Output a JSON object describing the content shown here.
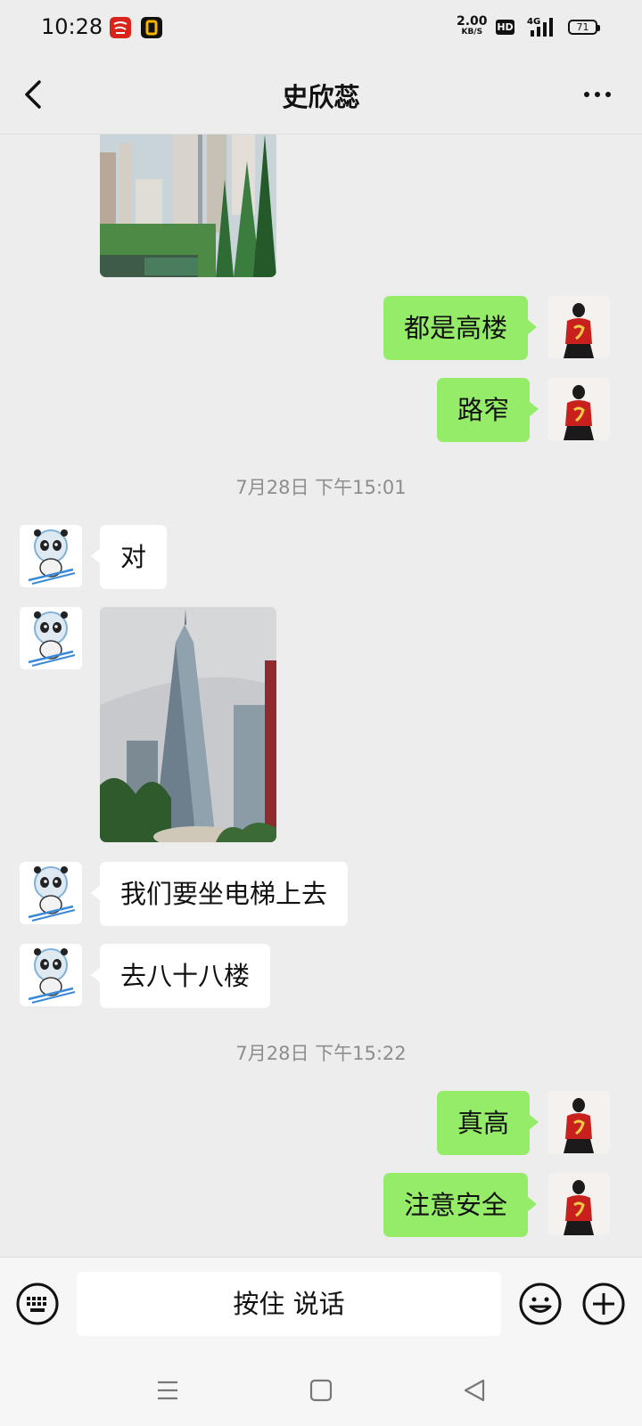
{
  "status_bar": {
    "time": "10:28",
    "net_speed": "2.00",
    "net_unit": "KB/S",
    "hd_label": "HD",
    "network_type": "4G",
    "battery": "71"
  },
  "header": {
    "title": "史欣蕊"
  },
  "messages": [
    {
      "type": "image",
      "direction": "in",
      "subject": "city street with trees and high-rise buildings"
    },
    {
      "type": "text",
      "direction": "out",
      "text": "都是高楼"
    },
    {
      "type": "text",
      "direction": "out",
      "text": "路窄"
    },
    {
      "type": "timestamp",
      "text": "7月28日 下午15:01"
    },
    {
      "type": "text",
      "direction": "in",
      "text": "对"
    },
    {
      "type": "image",
      "direction": "in",
      "subject": "skyscraper viewed from below"
    },
    {
      "type": "text",
      "direction": "in",
      "text": "我们要坐电梯上去"
    },
    {
      "type": "text",
      "direction": "in",
      "text": "去八十八楼"
    },
    {
      "type": "timestamp",
      "text": "7月28日 下午15:22"
    },
    {
      "type": "text",
      "direction": "out",
      "text": "真高"
    },
    {
      "type": "text",
      "direction": "out",
      "text": "注意安全"
    }
  ],
  "input_bar": {
    "voice_label": "按住 说话"
  },
  "icons": {
    "back": "chevron-left-icon",
    "more": "more-dots-icon",
    "keyboard": "keyboard-icon",
    "emoji": "emoji-icon",
    "plus": "plus-icon",
    "nav_menu": "nav-menu-icon",
    "nav_home": "nav-home-icon",
    "nav_back": "nav-back-icon"
  },
  "colors": {
    "outgoing_bubble": "#95ec69",
    "incoming_bubble": "#ffffff",
    "chat_background": "#ededed"
  }
}
